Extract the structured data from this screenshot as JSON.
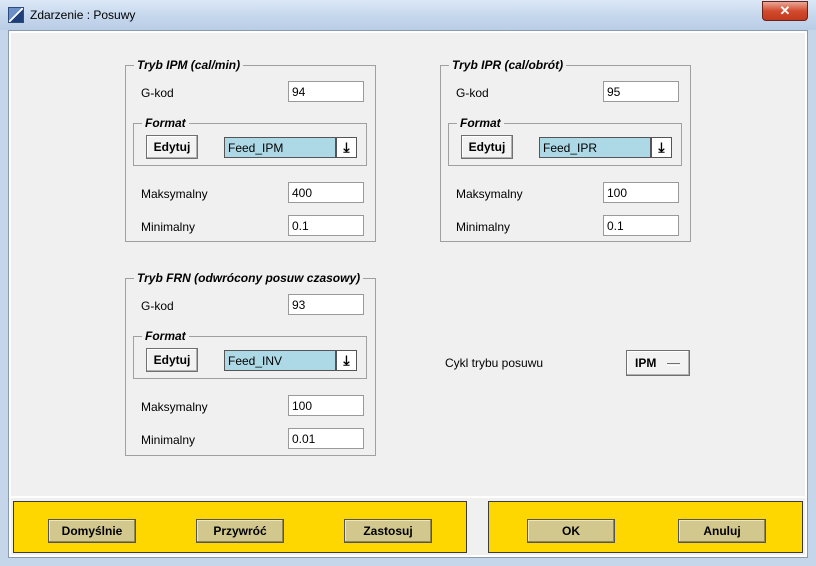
{
  "window": {
    "title": "Zdarzenie : Posuwy",
    "close_label": "✕"
  },
  "groups": {
    "ipm": {
      "title": "Tryb IPM (cal/min)",
      "gcode_label": "G-kod",
      "gcode_value": "94",
      "format_title": "Format",
      "edit_label": "Edytuj",
      "format_value": "Feed_IPM",
      "max_label": "Maksymalny",
      "max_value": "400",
      "min_label": "Minimalny",
      "min_value": "0.1"
    },
    "ipr": {
      "title": "Tryb IPR (cal/obrót)",
      "gcode_label": "G-kod",
      "gcode_value": "95",
      "format_title": "Format",
      "edit_label": "Edytuj",
      "format_value": "Feed_IPR",
      "max_label": "Maksymalny",
      "max_value": "100",
      "min_label": "Minimalny",
      "min_value": "0.1"
    },
    "frn": {
      "title": "Tryb FRN (odwrócony posuw czasowy)",
      "gcode_label": "G-kod",
      "gcode_value": "93",
      "format_title": "Format",
      "edit_label": "Edytuj",
      "format_value": "Feed_INV",
      "max_label": "Maksymalny",
      "max_value": "100",
      "min_label": "Minimalny",
      "min_value": "0.01"
    }
  },
  "cycle": {
    "label": "Cykl trybu posuwu",
    "value": "IPM"
  },
  "footer": {
    "defaults_label": "Domyślnie",
    "restore_label": "Przywróć",
    "apply_label": "Zastosuj",
    "ok_label": "OK",
    "cancel_label": "Anuluj"
  },
  "colors": {
    "footer_bar": "#ffd700",
    "footer_button": "#d2c88e",
    "combo_highlight": "#add8e6"
  },
  "icons": {
    "dropdown": "arrow-down-to-bar-icon",
    "window": "app-window-icon"
  }
}
